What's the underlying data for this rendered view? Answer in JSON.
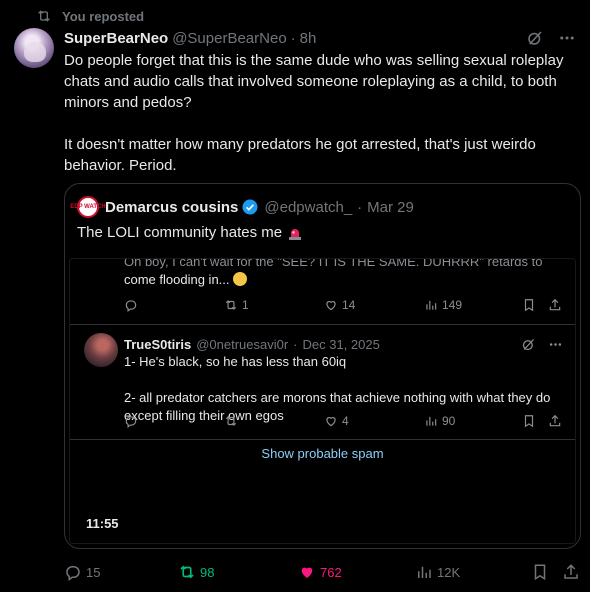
{
  "repost": {
    "label": "You reposted",
    "icon": "repost-icon"
  },
  "tweet": {
    "author_name": "SuperBearNeo",
    "author_handle": "@SuperBearNeo",
    "time": "8h",
    "text_p1": "Do people forget that this is the same dude who was selling sexual roleplay chats and audio calls that involved someone roleplaying as a child, to both minors and pedos?",
    "text_p2": "It doesn't matter how many predators he got arrested, that's just weirdo behavior. Period.",
    "stats": {
      "replies": "15",
      "reposts": "98",
      "likes": "762",
      "views": "12K"
    },
    "colors": {
      "repost_active": "#00ba7c",
      "like_active": "#f91880"
    }
  },
  "quote": {
    "avatar_text": "EDP WATCH",
    "author_name": "Demarcus cousins",
    "author_handle": "@edpwatch_",
    "date": "Mar 29",
    "text": "The LOLI community hates me",
    "timestamp": "11:55",
    "inner": {
      "prev_text_faded": "Oh boy, I can't wait for the \"SEE? IT IS THE SAME. DUHRRR\" retards to",
      "prev_text": "come flooding in...",
      "prev_stats": {
        "replies": "",
        "reposts": "1",
        "likes": "14",
        "views": "149"
      },
      "reply": {
        "author_name": "TrueS0tiris",
        "author_handle": "@0netruesavi0r",
        "date": "Dec 31, 2025",
        "line1": "1- He's black, so he has less than 60iq",
        "line2": "2- all predator catchers are morons that achieve nothing with what they do except filling their own egos",
        "stats": {
          "replies": "",
          "reposts": "",
          "likes": "4",
          "views": "90"
        }
      },
      "spam_link": "Show probable spam"
    }
  }
}
